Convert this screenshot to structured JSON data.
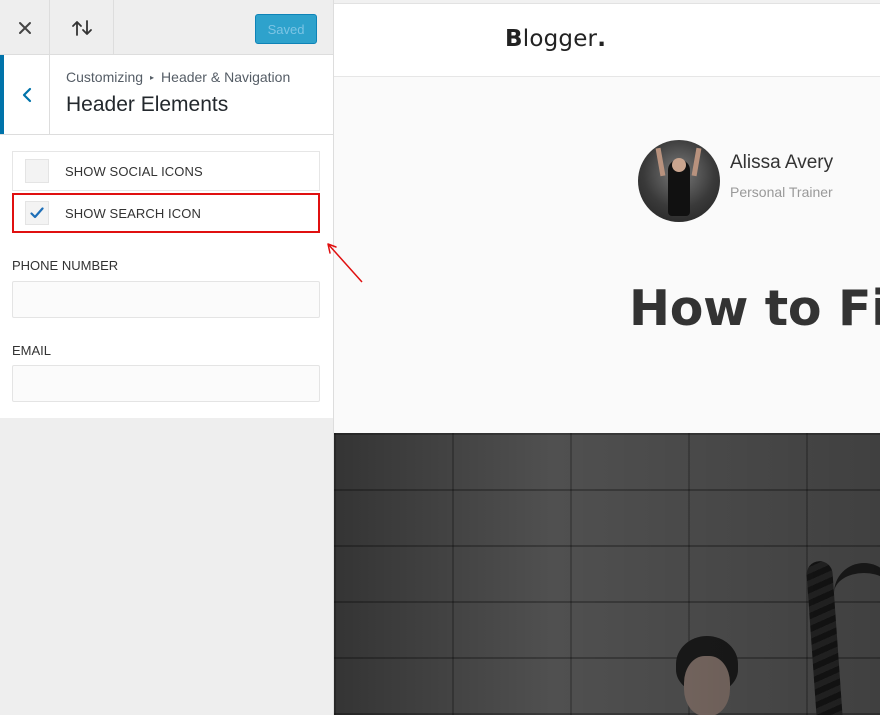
{
  "customizer": {
    "close_icon": "close-icon",
    "reorder_icon": "reorder-arrows-icon",
    "save_label": "Saved",
    "breadcrumb": {
      "root": "Customizing",
      "separator": "▸",
      "parent": "Header & Navigation"
    },
    "section_title": "Header Elements",
    "checkboxes": [
      {
        "label": "SHOW SOCIAL ICONS",
        "checked": false
      },
      {
        "label": "SHOW SEARCH ICON",
        "checked": true
      }
    ],
    "phone": {
      "label": "PHONE NUMBER",
      "value": ""
    },
    "email": {
      "label": "EMAIL",
      "value": ""
    }
  },
  "preview": {
    "logo_letter": "B",
    "logo_rest": "logger",
    "logo_dot": ".",
    "author_name": "Alissa Avery",
    "author_role": "Personal Trainer",
    "post_title": "How to Find"
  },
  "colors": {
    "accent": "#0073aa",
    "save_button": "#2ea2cc",
    "highlight": "#e01010"
  }
}
